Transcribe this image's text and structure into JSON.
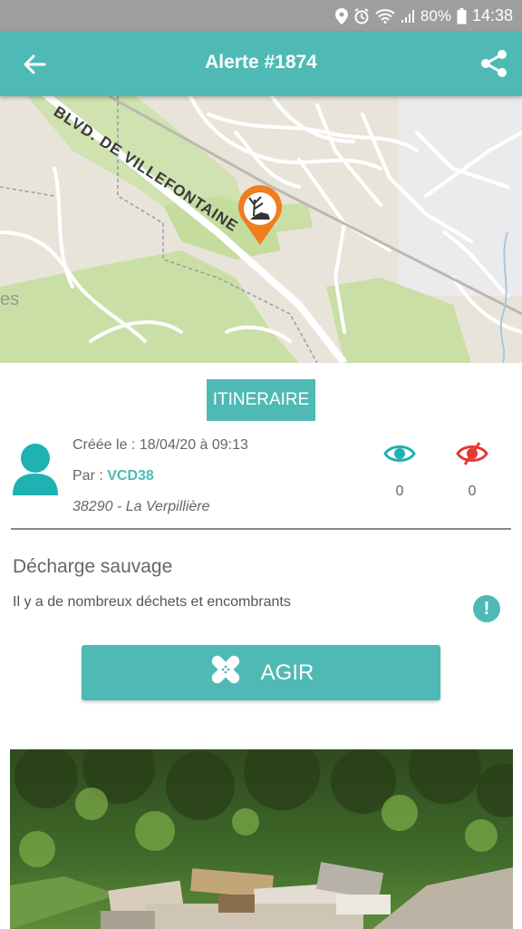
{
  "status_bar": {
    "battery": "80%",
    "time": "14:38"
  },
  "header": {
    "title": "Alerte #1874"
  },
  "map": {
    "street_label": "BLVD. DE VILLEFONTAINE",
    "edge_label": "es"
  },
  "itinerary_button": "ITINERAIRE",
  "meta": {
    "created": "Créée le : 18/04/20 à 09:13",
    "by_label": "Par : ",
    "by_user": "VCD38",
    "location": "38290 - La Verpillière"
  },
  "stats": {
    "views": "0",
    "hidden": "0"
  },
  "alert": {
    "category": "Décharge sauvage",
    "description": "Il y a de nombreux déchets et encombrants"
  },
  "action_button": "AGIR",
  "colors": {
    "primary": "#4fbab5",
    "status_bar": "#9e9e9e",
    "marker": "#f07d1e",
    "red": "#e53935"
  }
}
